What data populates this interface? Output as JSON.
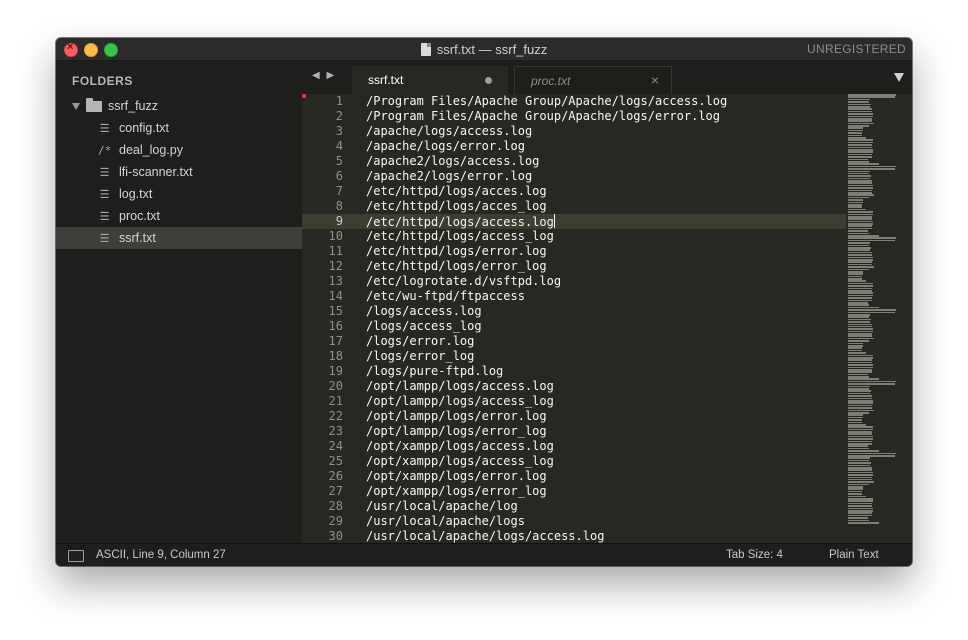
{
  "window": {
    "title": "ssrf.txt — ssrf_fuzz",
    "registration": "UNREGISTERED",
    "colors": {
      "background": "#272822",
      "sidebar": "#1e1f1c",
      "current_line": "#3e3d32",
      "close": "#fc605c",
      "minimize": "#fdbc40",
      "zoom": "#34c84a"
    }
  },
  "sidebar": {
    "heading": "FOLDERS",
    "folder": "ssrf_fuzz",
    "files": [
      {
        "name": "config.txt",
        "icon": "lines-icon",
        "glyph": "☰",
        "selected": false
      },
      {
        "name": "deal_log.py",
        "icon": "comment-icon",
        "glyph": "/*",
        "selected": false
      },
      {
        "name": "lfi-scanner.txt",
        "icon": "lines-icon",
        "glyph": "☰",
        "selected": false
      },
      {
        "name": "log.txt",
        "icon": "lines-icon",
        "glyph": "☰",
        "selected": false
      },
      {
        "name": "proc.txt",
        "icon": "lines-icon",
        "glyph": "☰",
        "selected": false
      },
      {
        "name": "ssrf.txt",
        "icon": "lines-icon",
        "glyph": "☰",
        "selected": true
      }
    ]
  },
  "tabs": [
    {
      "label": "ssrf.txt",
      "active": true,
      "dirty": true
    },
    {
      "label": "proc.txt",
      "active": false,
      "dirty": false,
      "close": "×"
    }
  ],
  "editor": {
    "current_line": 9,
    "line_numbers": [
      "1",
      "2",
      "3",
      "4",
      "5",
      "6",
      "7",
      "8",
      "9",
      "10",
      "11",
      "12",
      "13",
      "14",
      "15",
      "16",
      "17",
      "18",
      "19",
      "20",
      "21",
      "22",
      "23",
      "24",
      "25",
      "26",
      "27",
      "28",
      "29",
      "30"
    ],
    "lines": [
      "/Program Files/Apache Group/Apache/logs/access.log",
      "/Program Files/Apache Group/Apache/logs/error.log",
      "/apache/logs/access.log",
      "/apache/logs/error.log",
      "/apache2/logs/access.log",
      "/apache2/logs/error.log",
      "/etc/httpd/logs/acces.log",
      "/etc/httpd/logs/acces_log",
      "/etc/httpd/logs/access.log",
      "/etc/httpd/logs/access_log",
      "/etc/httpd/logs/error.log",
      "/etc/httpd/logs/error_log",
      "/etc/logrotate.d/vsftpd.log",
      "/etc/wu-ftpd/ftpaccess",
      "/logs/access.log",
      "/logs/access_log",
      "/logs/error.log",
      "/logs/error_log",
      "/logs/pure-ftpd.log",
      "/opt/lampp/logs/access.log",
      "/opt/lampp/logs/access_log",
      "/opt/lampp/logs/error.log",
      "/opt/lampp/logs/error_log",
      "/opt/xampp/logs/access.log",
      "/opt/xampp/logs/access_log",
      "/opt/xampp/logs/error.log",
      "/opt/xampp/logs/error_log",
      "/usr/local/apache/log",
      "/usr/local/apache/logs",
      "/usr/local/apache/logs/access.log"
    ]
  },
  "status": {
    "position": "ASCII, Line 9, Column 27",
    "tab_size": "Tab Size: 4",
    "syntax": "Plain Text"
  }
}
